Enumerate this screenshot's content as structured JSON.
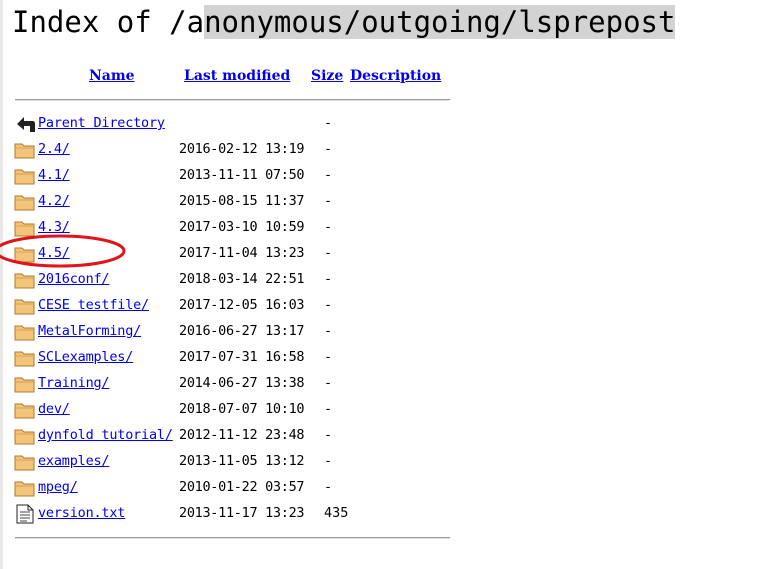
{
  "page": {
    "title_plain": "Index of /a",
    "title_highlight": "nonymous/outgoing/lsprepost"
  },
  "table": {
    "headers": {
      "name": "Name",
      "last_modified": "Last modified",
      "size": "Size",
      "description": "Description"
    },
    "rows": [
      {
        "icon": "back-icon",
        "name": "Parent Directory",
        "date": "",
        "size": "-"
      },
      {
        "icon": "folder-icon",
        "name": "2.4/",
        "date": "2016-02-12 13:19",
        "size": "-"
      },
      {
        "icon": "folder-icon",
        "name": "4.1/",
        "date": "2013-11-11 07:50",
        "size": "-"
      },
      {
        "icon": "folder-icon",
        "name": "4.2/",
        "date": "2015-08-15 11:37",
        "size": "-"
      },
      {
        "icon": "folder-icon",
        "name": "4.3/",
        "date": "2017-03-10 10:59",
        "size": "-"
      },
      {
        "icon": "folder-icon",
        "name": "4.5/",
        "date": "2017-11-04 13:23",
        "size": "-"
      },
      {
        "icon": "folder-icon",
        "name": "2016conf/",
        "date": "2018-03-14 22:51",
        "size": "-"
      },
      {
        "icon": "folder-icon",
        "name": "CESE testfile/",
        "date": "2017-12-05 16:03",
        "size": "-"
      },
      {
        "icon": "folder-icon",
        "name": "MetalForming/",
        "date": "2016-06-27 13:17",
        "size": "-"
      },
      {
        "icon": "folder-icon",
        "name": "SCLexamples/",
        "date": "2017-07-31 16:58",
        "size": "-"
      },
      {
        "icon": "folder-icon",
        "name": "Training/",
        "date": "2014-06-27 13:38",
        "size": "-"
      },
      {
        "icon": "folder-icon",
        "name": "dev/",
        "date": "2018-07-07 10:10",
        "size": "-"
      },
      {
        "icon": "folder-icon",
        "name": "dynfold tutorial/",
        "date": "2012-11-12 23:48",
        "size": "-"
      },
      {
        "icon": "folder-icon",
        "name": "examples/",
        "date": "2013-11-05 13:12",
        "size": "-"
      },
      {
        "icon": "folder-icon",
        "name": "mpeg/",
        "date": "2010-01-22 03:57",
        "size": "-"
      },
      {
        "icon": "text-file-icon",
        "name": "version.txt",
        "date": "2013-11-17 13:23",
        "size": "435"
      }
    ]
  },
  "colors": {
    "link": "#0000ee",
    "folder": "#f4c47a",
    "annotation": "#e0141b",
    "highlight": "#d3d3d3"
  }
}
